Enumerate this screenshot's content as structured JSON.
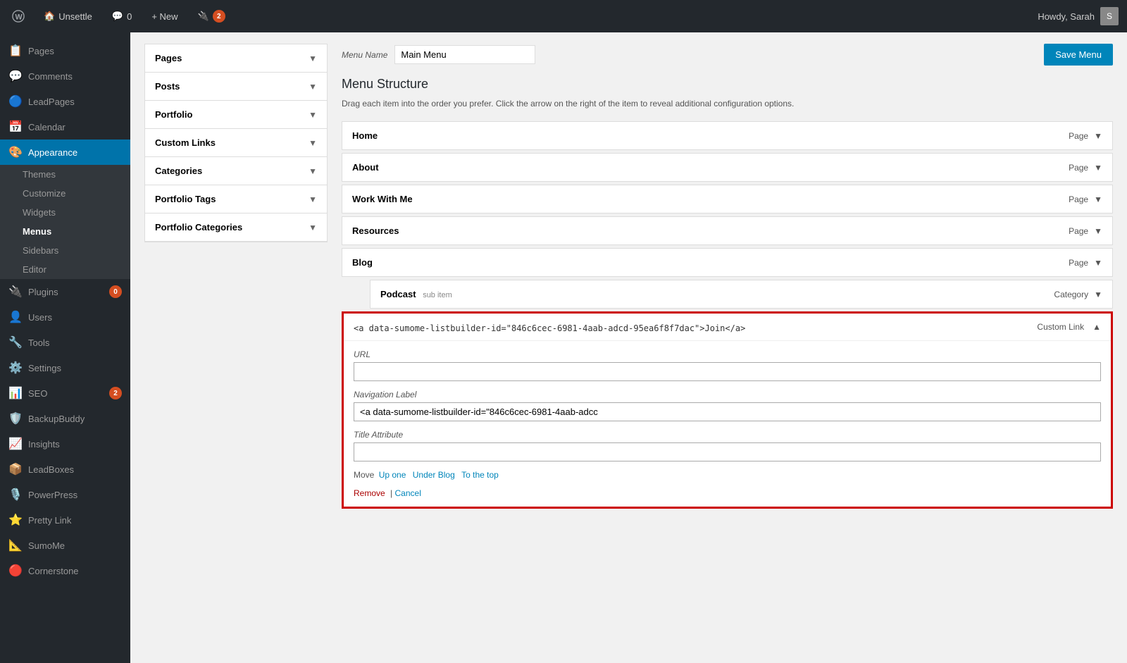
{
  "adminbar": {
    "wp_logo": "W",
    "site_name": "Unsettle",
    "comments_icon": "💬",
    "comments_count": "0",
    "new_label": "+ New",
    "new_item_label": "New",
    "seo_icon": "🔌",
    "seo_badge": "2",
    "howdy": "Howdy, Sarah",
    "avatar_initials": "S"
  },
  "sidebar": {
    "items": [
      {
        "id": "pages",
        "icon": "📋",
        "label": "Pages",
        "badge": null
      },
      {
        "id": "comments",
        "icon": "💬",
        "label": "Comments",
        "badge": null
      },
      {
        "id": "leadpages",
        "icon": "🔵",
        "label": "LeadPages",
        "badge": null
      },
      {
        "id": "calendar",
        "icon": "📅",
        "label": "Calendar",
        "badge": null
      },
      {
        "id": "appearance",
        "icon": "🎨",
        "label": "Appearance",
        "badge": null,
        "active": true
      },
      {
        "id": "plugins",
        "icon": "🔌",
        "label": "Plugins",
        "badge": "0"
      },
      {
        "id": "users",
        "icon": "👤",
        "label": "Users",
        "badge": null
      },
      {
        "id": "tools",
        "icon": "🔧",
        "label": "Tools",
        "badge": null
      },
      {
        "id": "settings",
        "icon": "⚙️",
        "label": "Settings",
        "badge": null
      },
      {
        "id": "seo",
        "icon": "📊",
        "label": "SEO",
        "badge": "2"
      },
      {
        "id": "backupbuddy",
        "icon": "🛡️",
        "label": "BackupBuddy",
        "badge": null
      },
      {
        "id": "insights",
        "icon": "📈",
        "label": "Insights",
        "badge": null
      },
      {
        "id": "leadboxes",
        "icon": "📦",
        "label": "LeadBoxes",
        "badge": null
      },
      {
        "id": "powerpress",
        "icon": "🎙️",
        "label": "PowerPress",
        "badge": null
      },
      {
        "id": "prettylink",
        "icon": "⭐",
        "label": "Pretty Link",
        "badge": null
      },
      {
        "id": "sumome",
        "icon": "📐",
        "label": "SumoMe",
        "badge": null
      },
      {
        "id": "cornerstone",
        "icon": "🔴",
        "label": "Cornerstone",
        "badge": null
      }
    ],
    "submenu": {
      "parent": "appearance",
      "items": [
        {
          "id": "themes",
          "label": "Themes",
          "active": false
        },
        {
          "id": "customize",
          "label": "Customize",
          "active": false
        },
        {
          "id": "widgets",
          "label": "Widgets",
          "active": false
        },
        {
          "id": "menus",
          "label": "Menus",
          "active": true
        },
        {
          "id": "sidebars",
          "label": "Sidebars",
          "active": false
        },
        {
          "id": "editor",
          "label": "Editor",
          "active": false
        }
      ]
    }
  },
  "accordion": {
    "items": [
      {
        "id": "pages",
        "label": "Pages"
      },
      {
        "id": "posts",
        "label": "Posts"
      },
      {
        "id": "portfolio",
        "label": "Portfolio"
      },
      {
        "id": "custom_links",
        "label": "Custom Links"
      },
      {
        "id": "categories",
        "label": "Categories"
      },
      {
        "id": "portfolio_tags",
        "label": "Portfolio Tags"
      },
      {
        "id": "portfolio_categories",
        "label": "Portfolio Categories"
      }
    ]
  },
  "menu_name_label": "Menu Name",
  "menu_name_value": "Main Menu",
  "save_menu_label": "Save Menu",
  "menu_structure_title": "Menu Structure",
  "menu_structure_desc": "Drag each item into the order you prefer. Click the arrow on the right of the item to reveal additional configuration options.",
  "menu_items": [
    {
      "id": "home",
      "label": "Home",
      "type": "Page",
      "sub": false
    },
    {
      "id": "about",
      "label": "About",
      "type": "Page",
      "sub": false
    },
    {
      "id": "work_with_me",
      "label": "Work With Me",
      "type": "Page",
      "sub": false
    },
    {
      "id": "resources",
      "label": "Resources",
      "type": "Page",
      "sub": false
    },
    {
      "id": "blog",
      "label": "Blog",
      "type": "Page",
      "sub": false
    },
    {
      "id": "podcast",
      "label": "Podcast",
      "sub_label": "sub item",
      "type": "Category",
      "sub": true
    }
  ],
  "expanded_item": {
    "title": "<a data-sumome-listbuilder-id=\"846c6cec-6981-4aab-adcd-95ea6f8f7dac\">Join</a>",
    "type": "Custom Link",
    "url_label": "URL",
    "url_value": "",
    "nav_label": "Navigation Label",
    "nav_value": "<a data-sumome-listbuilder-id=\"846c6cec-6981-4aab-adcc",
    "title_attr_label": "Title Attribute",
    "title_attr_value": "",
    "move_label": "Move",
    "move_links": [
      {
        "id": "up_one",
        "label": "Up one"
      },
      {
        "id": "under_blog",
        "label": "Under Blog"
      },
      {
        "id": "to_top",
        "label": "To the top"
      }
    ],
    "remove_label": "Remove",
    "cancel_label": "Cancel"
  }
}
